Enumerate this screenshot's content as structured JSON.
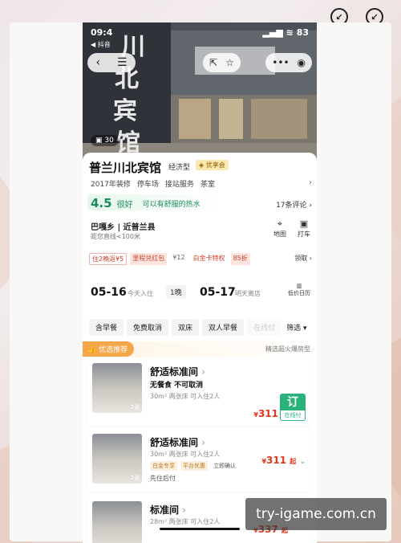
{
  "status_bar": {
    "time": "09:4",
    "app": "◀ 抖音",
    "battery": "83"
  },
  "photo": {
    "count": "30",
    "sign_chars": [
      "川",
      "北",
      "宾",
      "馆"
    ]
  },
  "hotel": {
    "name": "普兰川北宾馆",
    "type": "经济型",
    "vip": "优享会",
    "facilities": [
      "2017年装修",
      "停车场",
      "接站服务",
      "茶室"
    ],
    "score": "4.5",
    "score_label": "很好",
    "comment": "可以有舒服的热水",
    "reviews": "17条评论",
    "location": "巴嘎乡 | 近普兰县",
    "distance": "距您直线<100米",
    "map_label": "地图",
    "taxi_label": "打车"
  },
  "promos": [
    {
      "text": "住2晚返¥5",
      "style": "box"
    },
    {
      "text": "里程兑红包",
      "style": "fill"
    },
    {
      "text": "¥12",
      "style": "gray"
    },
    {
      "text": "白金卡特权",
      "style": "plain"
    },
    {
      "text": "85折",
      "style": "fill"
    }
  ],
  "promo_claim": "领取",
  "stay": {
    "checkin": "05-16",
    "checkin_sub": "今天入住",
    "nights": "1晚",
    "checkout": "05-17",
    "checkout_sub": "明天离店",
    "low_price": "低价日历"
  },
  "filters": [
    "含早餐",
    "免费取消",
    "双床",
    "双人早餐",
    "在线付"
  ],
  "sort_label": "筛选",
  "recommend": {
    "badge": "优选推荐",
    "right": "精选超火爆房型"
  },
  "rooms": [
    {
      "title": "舒适标准间",
      "line1": "无餐食  不可取消",
      "line2": "30m²  两张床  可入住2人",
      "price": "311",
      "book": "订",
      "book_sub": "在线付",
      "img_count": "2张"
    },
    {
      "title": "舒适标准间",
      "line1": "30m²  两张床  可入住2人",
      "tags": [
        "白金专享",
        "平台优惠",
        "立即确认"
      ],
      "extra": "先住后付",
      "price": "311",
      "suffix": "起",
      "img_count": "2张"
    },
    {
      "title": "标准间",
      "line1": "28m²  两张床  可入住2人",
      "price": "337",
      "suffix": "起"
    }
  ],
  "watermark": "try-igame.com.cn"
}
